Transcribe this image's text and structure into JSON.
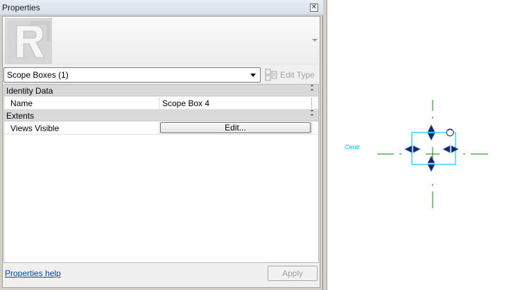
{
  "palette": {
    "title": "Properties",
    "close_icon": "close-icon"
  },
  "type_selector": {
    "value": "Scope Boxes (1)",
    "thumbnail_icon": "revit-logo-icon"
  },
  "edit_type": {
    "label": "Edit Type",
    "enabled": false
  },
  "groups": [
    {
      "label": "Identity Data",
      "rows": [
        {
          "name": "Name",
          "value": "Scope Box 4"
        }
      ]
    },
    {
      "label": "Extents",
      "rows": [
        {
          "name": "Views Visible",
          "button": "Edit..."
        }
      ]
    }
  ],
  "footer": {
    "help_link": "Properties help",
    "apply_label": "Apply"
  },
  "canvas": {
    "label_text": "Centr",
    "colors": {
      "scope_box": "#00d0ff",
      "centerline": "#008a00",
      "grip": "#0e2a66"
    }
  }
}
